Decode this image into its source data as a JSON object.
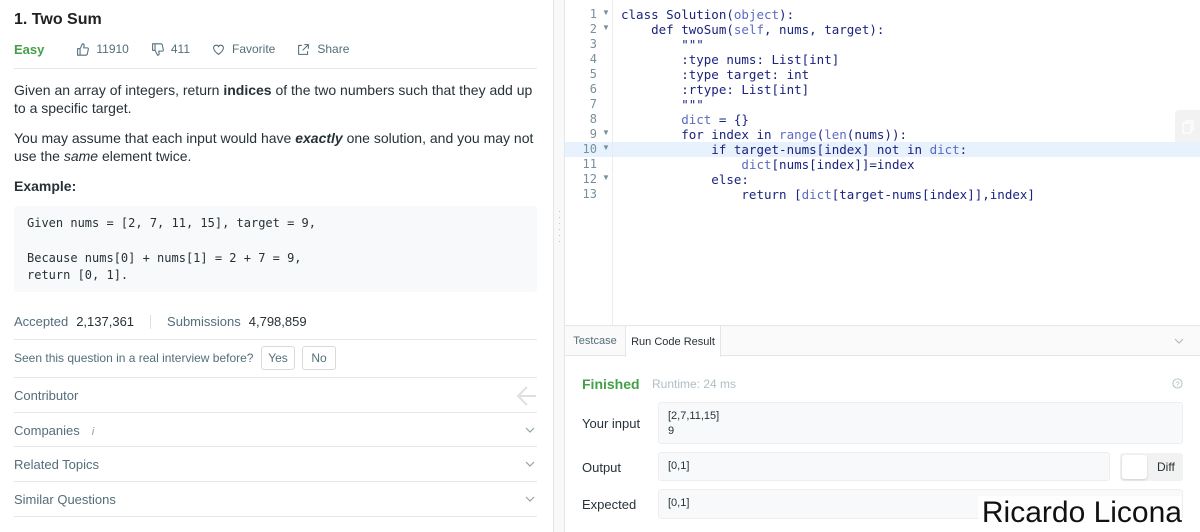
{
  "problem": {
    "title": "1. Two Sum",
    "difficulty": "Easy",
    "likes": "11910",
    "dislikes": "411",
    "favorite_label": "Favorite",
    "share_label": "Share",
    "desc_p1_a": "Given an array of integers, return ",
    "desc_p1_b": "indices",
    "desc_p1_c": " of the two numbers such that they add up to a specific target.",
    "desc_p2_a": "You may assume that each input would have ",
    "desc_p2_b": "exactly",
    "desc_p2_c": " one solution, and you may not use the ",
    "desc_p2_d": "same",
    "desc_p2_e": " element twice.",
    "example_label": "Example:",
    "example_lines": [
      "Given nums = [2, 7, 11, 15], target = 9,",
      "",
      "Because nums[0] + nums[1] = 2 + 7 = 9,",
      "return [0, 1]."
    ],
    "accepted_label": "Accepted",
    "accepted_value": "2,137,361",
    "submissions_label": "Submissions",
    "submissions_value": "4,798,859",
    "seen_question": "Seen this question in a real interview before?",
    "yes_label": "Yes",
    "no_label": "No",
    "contributor_label": "Contributor",
    "companies_label": "Companies",
    "companies_info": "i",
    "related_topics_label": "Related Topics",
    "similar_questions_label": "Similar Questions"
  },
  "editor": {
    "line_numbers": [
      "1",
      "2",
      "3",
      "4",
      "5",
      "6",
      "7",
      "8",
      "9",
      "10",
      "11",
      "12",
      "13"
    ],
    "fold_lines": [
      "1",
      "2",
      "9",
      "10",
      "12"
    ],
    "active_line": "10",
    "code_lines": [
      "class Solution(object):",
      "    def twoSum(self, nums, target):",
      "        \"\"\"",
      "        :type nums: List[int]",
      "        :type target: int",
      "        :rtype: List[int]",
      "        \"\"\"",
      "        dict = {}",
      "        for index in range(len(nums)):",
      "            if target-nums[index] not in dict:",
      "                dict[nums[index]]=index",
      "            else:",
      "                return [dict[target-nums[index]],index]"
    ]
  },
  "result": {
    "tab_testcase": "Testcase",
    "tab_run_code_result": "Run Code Result",
    "status": "Finished",
    "runtime": "Runtime: 24 ms",
    "your_input_label": "Your input",
    "your_input_value": "[2,7,11,15]\n9",
    "output_label": "Output",
    "output_value": "[0,1]",
    "expected_label": "Expected",
    "expected_value": "[0,1]",
    "diff_label": "Diff"
  },
  "watermark": "Ricardo Licona",
  "colors": {
    "easy": "#43a047",
    "finished": "#43a047",
    "active_line": "#e8f2ff",
    "code_text": "#1a237e",
    "builtin": "#5c6bc0"
  }
}
